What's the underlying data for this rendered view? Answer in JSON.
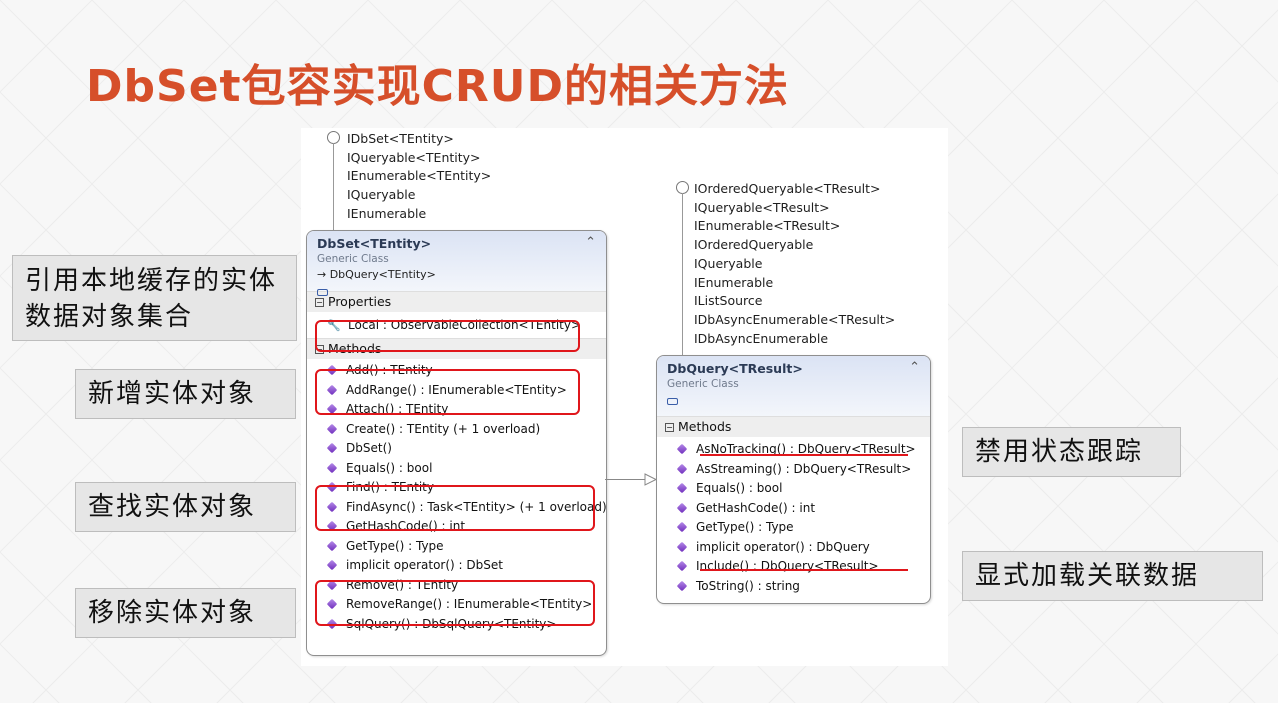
{
  "slide": {
    "title": "DbSet包容实现CRUD的相关方法"
  },
  "side_labels": {
    "local_cache": "引用本地缓存的实体数据对象集合",
    "add": "新增实体对象",
    "find": "查找实体对象",
    "remove": "移除实体对象",
    "no_tracking": "禁用状态跟踪",
    "explicit_load": "显式加载关联数据"
  },
  "dbset_interfaces": [
    "IDbSet<TEntity>",
    "IQueryable<TEntity>",
    "IEnumerable<TEntity>",
    "IQueryable",
    "IEnumerable"
  ],
  "dbquery_interfaces": [
    "IOrderedQueryable<TResult>",
    "IQueryable<TResult>",
    "IEnumerable<TResult>",
    "IOrderedQueryable",
    "IQueryable",
    "IEnumerable",
    "IListSource",
    "IDbAsyncEnumerable<TResult>",
    "IDbAsyncEnumerable"
  ],
  "dbset_class": {
    "name": "DbSet<TEntity>",
    "kind": "Generic Class",
    "base": "→ DbQuery<TEntity>",
    "properties_header": "Properties",
    "properties": [
      "Local : ObservableCollection<TEntity>"
    ],
    "methods_header": "Methods",
    "methods": [
      "Add() : TEntity",
      "AddRange() : IEnumerable<TEntity>",
      "Attach() : TEntity",
      "Create() : TEntity (+ 1 overload)",
      "DbSet()",
      "Equals() : bool",
      "Find() : TEntity",
      "FindAsync() : Task<TEntity> (+ 1 overload)",
      "GetHashCode() : int",
      "GetType() : Type",
      "implicit operator() : DbSet",
      "Remove() : TEntity",
      "RemoveRange() : IEnumerable<TEntity>",
      "SqlQuery() : DbSqlQuery<TEntity>"
    ]
  },
  "dbquery_class": {
    "name": "DbQuery<TResult>",
    "kind": "Generic Class",
    "methods_header": "Methods",
    "methods": [
      "AsNoTracking() : DbQuery<TResult>",
      "AsStreaming() : DbQuery<TResult>",
      "Equals() : bool",
      "GetHashCode() : int",
      "GetType() : Type",
      "implicit operator() : DbQuery",
      "Include() : DbQuery<TResult>",
      "ToString() : string"
    ]
  },
  "colors": {
    "title": "#d64f2a",
    "highlight": "#e0161b",
    "label_bg": "#e6e6e6"
  },
  "icons": {
    "collapse": "double-chevron-up-icon",
    "method": "purple-cube-icon",
    "property": "wrench-icon"
  }
}
